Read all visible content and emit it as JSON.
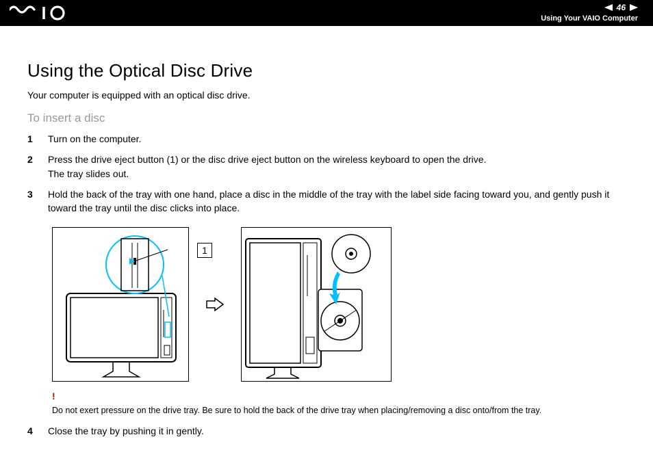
{
  "header": {
    "page_number": "46",
    "section": "Using Your VAIO Computer"
  },
  "title": "Using the Optical Disc Drive",
  "intro": "Your computer is equipped with an optical disc drive.",
  "subheading": "To insert a disc",
  "steps": {
    "s1": {
      "num": "1",
      "text": "Turn on the computer."
    },
    "s2": {
      "num": "2",
      "line1": "Press the drive eject button (1) or the disc drive eject button on the wireless keyboard to open the drive.",
      "line2": "The tray slides out."
    },
    "s3": {
      "num": "3",
      "text": "Hold the back of the tray with one hand, place a disc in the middle of the tray with the label side facing toward you, and gently push it toward the tray until the disc clicks into place."
    },
    "s4": {
      "num": "4",
      "text": "Close the tray by pushing it in gently."
    }
  },
  "callout": "1",
  "caution": {
    "mark": "!",
    "text": "Do not exert pressure on the drive tray. Be sure to hold the back of the drive tray when placing/removing a disc onto/from the tray."
  }
}
